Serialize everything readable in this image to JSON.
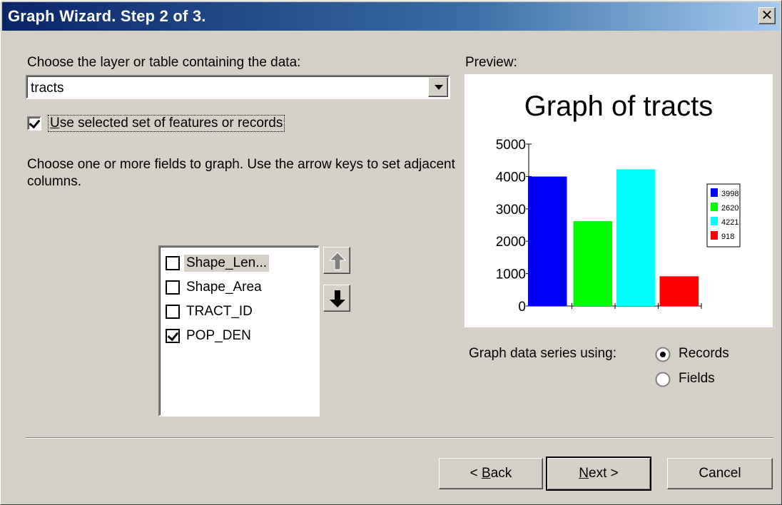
{
  "window": {
    "title": "Graph Wizard. Step 2 of 3.",
    "close_glyph": "✕"
  },
  "layer": {
    "label": "Choose the layer or table containing the data:",
    "selected": "tracts"
  },
  "use_selected": {
    "mnemonic": "U",
    "rest": "se selected set of features or records",
    "checked": true
  },
  "fields": {
    "label": "Choose one or more fields to graph. Use the arrow keys to set adjacent columns.",
    "items": [
      {
        "label": "Shape_Len...",
        "checked": false,
        "highlighted": true
      },
      {
        "label": "Shape_Area",
        "checked": false,
        "highlighted": false
      },
      {
        "label": "TRACT_ID",
        "checked": false,
        "highlighted": false
      },
      {
        "label": "POP_DEN",
        "checked": true,
        "highlighted": false
      }
    ],
    "move_up_icon": "arrow-up-icon",
    "move_down_icon": "arrow-down-icon"
  },
  "preview": {
    "label": "Preview:"
  },
  "chart_data": {
    "type": "bar",
    "title": "Graph of tracts",
    "categories": [
      "3998",
      "2620",
      "4221",
      "918"
    ],
    "values": [
      3998,
      2620,
      4221,
      918
    ],
    "colors": [
      "#0000ff",
      "#00ff00",
      "#00ffff",
      "#ff0000"
    ],
    "yticks": [
      0,
      1000,
      2000,
      3000,
      4000,
      5000
    ],
    "ylim": [
      0,
      5000
    ],
    "legend": [
      "3998",
      "2620",
      "4221",
      "918"
    ],
    "legend_position": "right",
    "grid": false
  },
  "series_using": {
    "label": "Graph data series using:",
    "options": [
      "Records",
      "Fields"
    ],
    "selected": "Records"
  },
  "buttons": {
    "back_mnemonic": "B",
    "back_rest": "ack",
    "back_prefix": "< ",
    "next_mnemonic": "N",
    "next_rest": "ext >",
    "cancel": "Cancel"
  }
}
